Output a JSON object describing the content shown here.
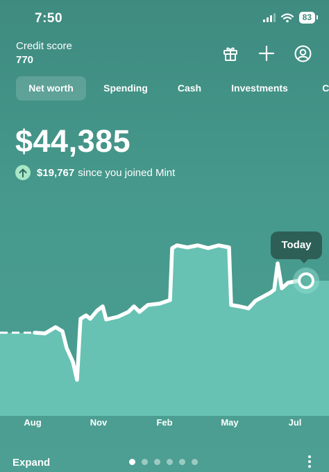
{
  "status": {
    "time": "7:50",
    "battery": "83"
  },
  "score": {
    "label": "Credit score",
    "value": "770"
  },
  "tabs": [
    "Net worth",
    "Spending",
    "Cash",
    "Investments",
    "Cr"
  ],
  "active_tab": 0,
  "summary": {
    "amount": "$44,385",
    "delta_value": "$19,767",
    "delta_text": "since you joined Mint"
  },
  "tooltip": "Today",
  "months": [
    "Aug",
    "Nov",
    "Feb",
    "May",
    "Jul"
  ],
  "bottom": {
    "expand_label": "Expand",
    "pages": 6,
    "active_page": 0
  },
  "colors": {
    "background": "#469a8d",
    "fill": "#6ac6b6",
    "line": "#ffffff",
    "delta_badge": "#a8e7c7"
  }
}
